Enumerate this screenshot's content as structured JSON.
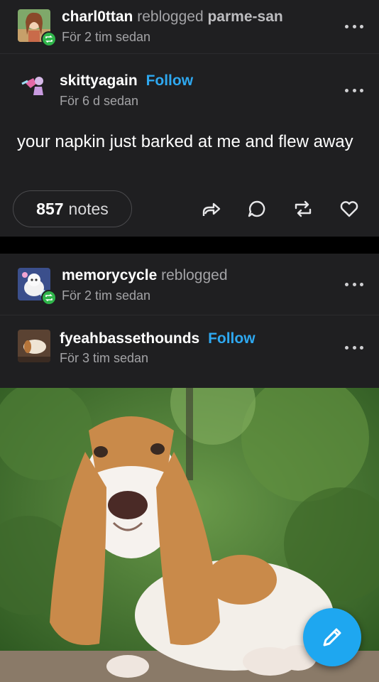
{
  "post1": {
    "reblogger": "charl0ttan",
    "reblogged_word": "reblogged",
    "source": "parme-san",
    "reblog_time": "För 2 tim sedan",
    "author": "skittyagain",
    "follow_label": "Follow",
    "author_time": "För 6 d sedan",
    "body_text": "your napkin just barked at me and flew away",
    "notes_count": "857",
    "notes_label": "notes"
  },
  "post2": {
    "reblogger": "memorycycle",
    "reblogged_word": "reblogged",
    "reblog_time": "För 2 tim sedan",
    "author": "fyeahbassethounds",
    "follow_label": "Follow",
    "author_time": "För 3 tim sedan"
  },
  "icons": [
    "more-icon",
    "reblog-badge-icon",
    "share-icon",
    "reply-icon",
    "reblog-icon",
    "like-icon",
    "pencil-icon"
  ],
  "colors": {
    "background": "#1f1f21",
    "accent": "#2ea8f0",
    "reblog_green": "#2fb54a",
    "fab": "#1ea7f0"
  }
}
